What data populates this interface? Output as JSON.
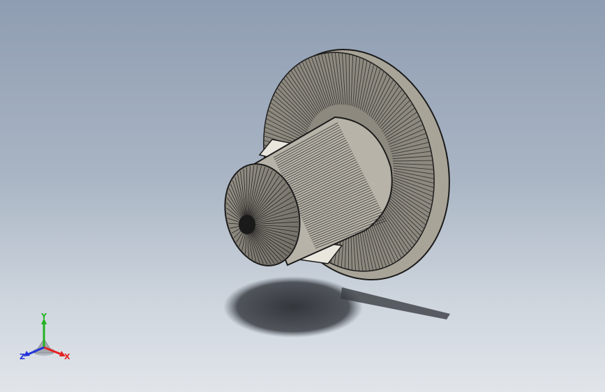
{
  "viewport": {
    "background_top": "#8f9db2",
    "background_bottom": "#e1e5ea"
  },
  "model": {
    "part_color": "#b6b1a6",
    "edge_color": "#1b1b1b",
    "shadow_color": "#2c2f33"
  },
  "triad": {
    "x_label": "X",
    "y_label": "Y",
    "z_label": "Z",
    "x_color": "#e52222",
    "y_color": "#22b322",
    "z_color": "#2233d9"
  }
}
